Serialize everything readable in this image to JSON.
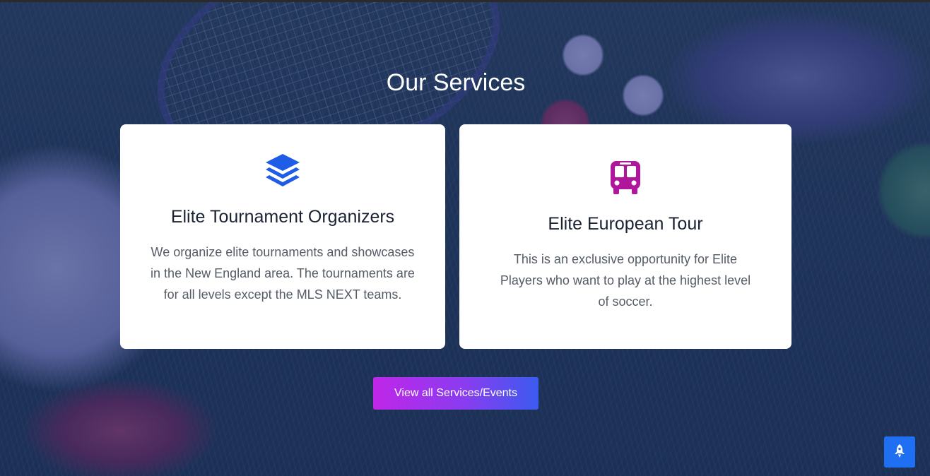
{
  "section": {
    "title": "Our Services"
  },
  "services": [
    {
      "icon": "layers-icon",
      "icon_color": "#1f5ce8",
      "title": "Elite Tournament Organizers",
      "description": "We organize elite tournaments and showcases in the New England area. The tournaments are for all levels except the MLS NEXT teams."
    },
    {
      "icon": "bus-icon",
      "icon_color": "#b0169c",
      "title": "Elite European Tour",
      "description": "This is an exclusive opportunity for Elite Players who want to play at the highest level of soccer."
    }
  ],
  "cta": {
    "label": "View all Services/Events"
  },
  "scroll_top": {
    "icon": "rocket-icon",
    "color": "#1f6ff2"
  },
  "colors": {
    "overlay": "#1e2878",
    "button_gradient": [
      "#c026e8",
      "#3b5bf0"
    ]
  }
}
